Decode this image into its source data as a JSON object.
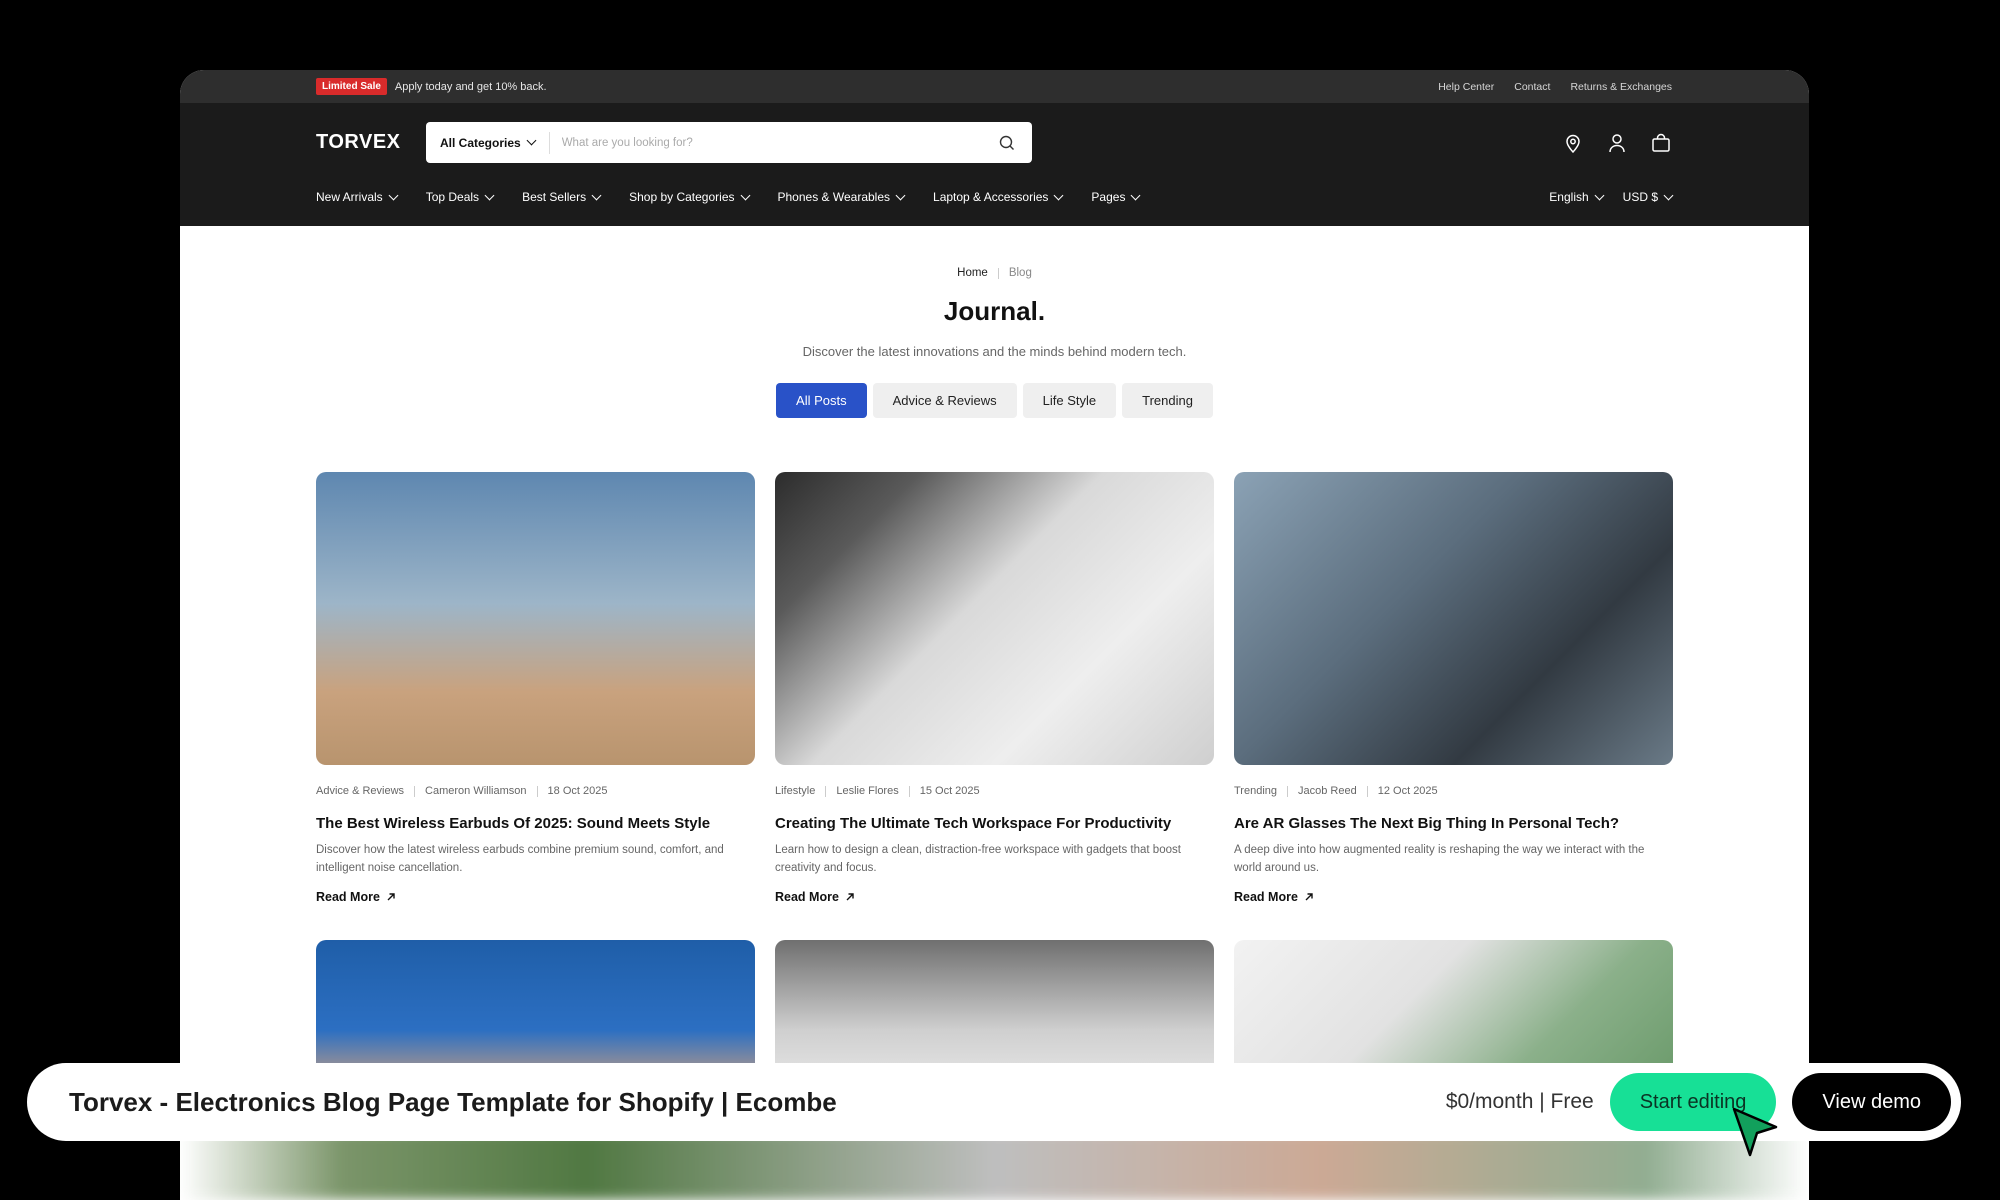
{
  "topbar": {
    "sale_badge": "Limited Sale",
    "promo": "Apply today and get 10% back.",
    "links": [
      "Help Center",
      "Contact",
      "Returns & Exchanges"
    ]
  },
  "header": {
    "logo": "TORVEX",
    "search": {
      "category": "All Categories",
      "placeholder": "What are you looking for?"
    },
    "icons": [
      "location-icon",
      "user-icon",
      "bag-icon"
    ],
    "nav": [
      "New Arrivals",
      "Top Deals",
      "Best Sellers",
      "Shop by Categories",
      "Phones & Wearables",
      "Laptop & Accessories",
      "Pages"
    ],
    "language": "English",
    "currency": "USD $"
  },
  "breadcrumb": {
    "home": "Home",
    "current": "Blog"
  },
  "page": {
    "title": "Journal.",
    "subtitle": "Discover the latest innovations and the minds behind modern tech."
  },
  "filters": [
    "All Posts",
    "Advice & Reviews",
    "Life Style",
    "Trending"
  ],
  "active_filter": "All Posts",
  "posts": [
    {
      "category": "Advice & Reviews",
      "author": "Cameron Williamson",
      "date": "18 Oct 2025",
      "title": "The Best Wireless Earbuds Of 2025: Sound Meets Style",
      "excerpt": "Discover how the latest wireless earbuds combine premium sound, comfort, and intelligent noise cancellation.",
      "read_more": "Read More"
    },
    {
      "category": "Lifestyle",
      "author": "Leslie Flores",
      "date": "15 Oct 2025",
      "title": "Creating The Ultimate Tech Workspace For Productivity",
      "excerpt": "Learn how to design a clean, distraction-free workspace with gadgets that boost creativity and focus.",
      "read_more": "Read More"
    },
    {
      "category": "Trending",
      "author": "Jacob Reed",
      "date": "12 Oct 2025",
      "title": "Are AR Glasses The Next Big Thing In Personal Tech?",
      "excerpt": "A deep dive into how augmented reality is reshaping the way we interact with the world around us.",
      "read_more": "Read More"
    }
  ],
  "bottom_bar": {
    "title": "Torvex - Electronics Blog Page Template for Shopify | Ecombe",
    "price": "$0/month | Free",
    "start_label": "Start editing",
    "demo_label": "View demo"
  },
  "colors": {
    "accent": "#2952c8",
    "sale": "#d92b2b",
    "cta": "#17e096"
  }
}
